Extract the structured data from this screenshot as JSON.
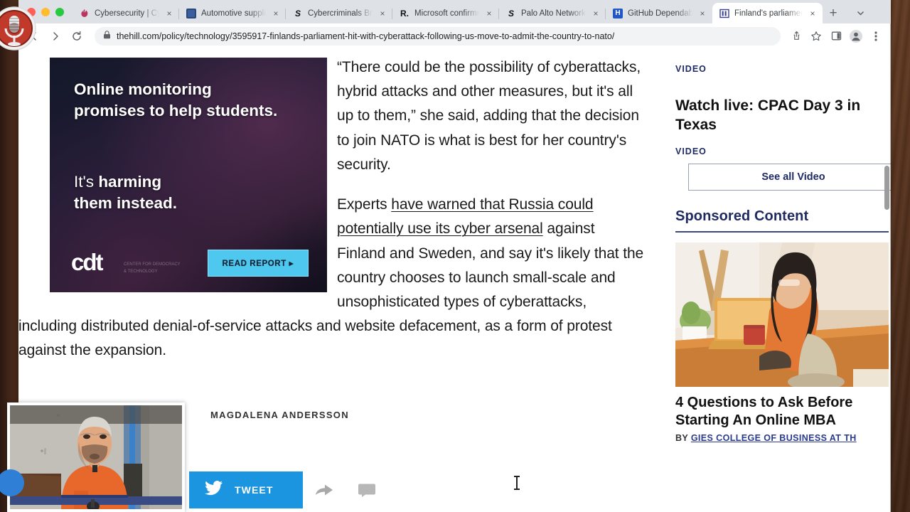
{
  "window": {
    "traffic_lights": [
      "close",
      "minimize",
      "zoom"
    ],
    "colors": {
      "close": "#ff5f57",
      "minimize": "#febc2e",
      "zoom": "#28c840",
      "accent_blue": "#1b95e0",
      "rail_navy": "#1f2a63"
    }
  },
  "tabs": [
    {
      "title": "Cybersecurity | Cybe",
      "favicon": "flame-icon",
      "favicon_color": "#b9375e",
      "active": false
    },
    {
      "title": "Automotive supplier",
      "favicon": "square-icon",
      "favicon_color": "#3b5f9e",
      "active": false
    },
    {
      "title": "Cybercriminals Brea",
      "favicon": "s-icon",
      "favicon_color": "#ffffff",
      "active": false
    },
    {
      "title": "Microsoft confirms 'D",
      "favicon": "r-icon",
      "favicon_color": "#ffffff",
      "active": false
    },
    {
      "title": "Palo Alto Networks F",
      "favicon": "s-icon",
      "favicon_color": "#ffffff",
      "active": false
    },
    {
      "title": "GitHub Dependabot",
      "favicon": "h-icon",
      "favicon_color": "#2256c5",
      "active": false
    },
    {
      "title": "Finland's parliament",
      "favicon": "bars-icon",
      "favicon_color": "#3b3f8f",
      "active": true
    }
  ],
  "tabstrip": {
    "new_tab_label": "+",
    "tab_search_label": "∨",
    "close_label": "×"
  },
  "toolbar": {
    "back_label": "←",
    "forward_label": "→",
    "reload_label": "↻",
    "lock_icon": "lock-icon",
    "url": "thehill.com/policy/technology/3595917-finlands-parliament-hit-with-cyberattack-following-us-move-to-admit-the-country-to-nato/",
    "icons": [
      "share-icon",
      "bookmark-star-icon",
      "side-panel-icon",
      "profile-avatar-icon",
      "kebab-menu-icon"
    ]
  },
  "ad": {
    "headline": "Online monitoring promises to help students.",
    "subhead_lite": "It's ",
    "subhead_bold": "harming",
    "subhead_line2": "them instead.",
    "logo": "cdt",
    "logo_sub": "CENTER FOR DEMOCRACY & TECHNOLOGY",
    "cta": "READ REPORT ▸"
  },
  "article": {
    "paragraph_1": "“There could be the possibility of cyberattacks, hybrid attacks and other measures, but it's all up to them,” she said, adding that the decision to join NATO is what is best for her country's security.",
    "paragraph_2_pre": "Experts ",
    "paragraph_2_link": "have warned that Russia could potentially use its cyber arsenal",
    "paragraph_2_post": " against Finland and Sweden, and say it's likely that the country chooses to launch small-scale and unsophisticated types of cyberattacks, including distributed denial-of-service attacks and website defacement, as a form of protest against the expansion.",
    "caption": "MAGDALENA ANDERSSON"
  },
  "share": {
    "tweet_label": "TWEET",
    "twitter_icon": "twitter-bird-icon",
    "forward_icon": "share-arrow-icon",
    "comment_icon": "comment-bubble-icon"
  },
  "rail": {
    "kicker_1": "VIDEO",
    "headline_line1": "Watch live: CPAC Day 3 in",
    "headline_line2": "Texas",
    "kicker_2": "VIDEO",
    "see_all_label": "See all Video",
    "sponsored_heading": "Sponsored Content",
    "promo_title_line1": "4 Questions to Ask Before",
    "promo_title_line2": "Starting An Online MBA",
    "promo_byline_prefix": "BY ",
    "promo_byline_source": "GIES COLLEGE OF BUSINESS AT TH"
  }
}
